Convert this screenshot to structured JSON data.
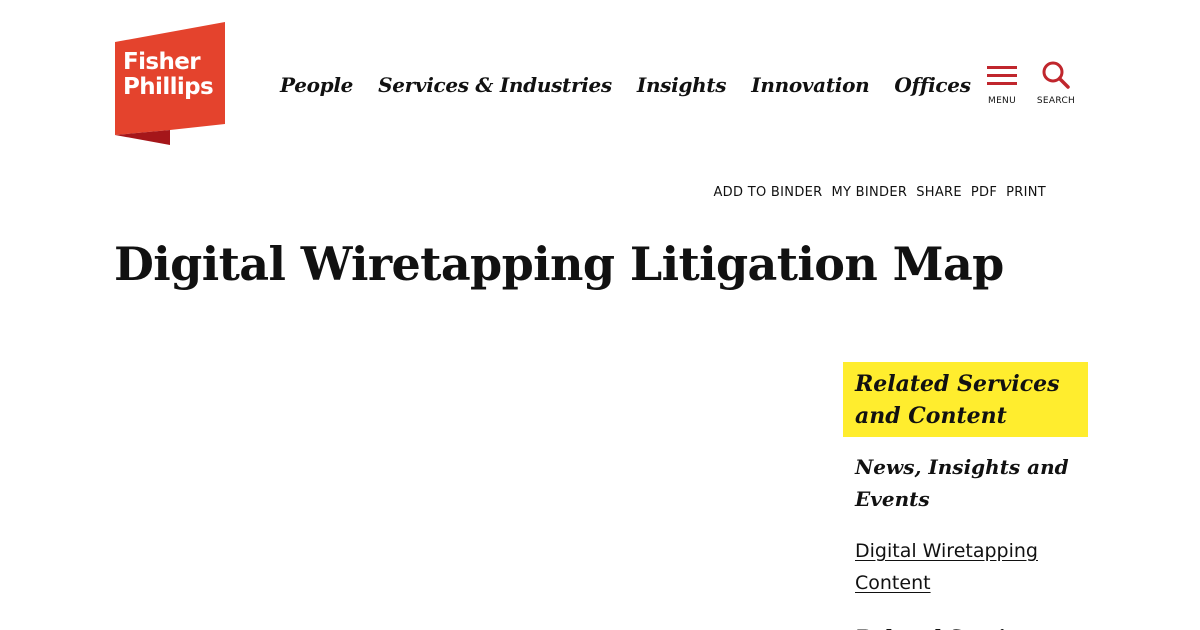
{
  "brand": {
    "line1": "Fisher",
    "line2": "Phillips",
    "color": "#e4432d",
    "shadow_color": "#a5161a"
  },
  "nav": {
    "items": [
      {
        "label": "People"
      },
      {
        "label": "Services & Industries"
      },
      {
        "label": "Insights"
      },
      {
        "label": "Innovation"
      },
      {
        "label": "Offices"
      }
    ]
  },
  "utility": {
    "menu_label": "MENU",
    "menu_icon": "hamburger-icon",
    "search_label": "SEARCH",
    "search_icon": "search-icon",
    "icon_color": "#c0262d"
  },
  "actions": [
    {
      "label": "ADD TO BINDER"
    },
    {
      "label": "MY BINDER"
    },
    {
      "label": "SHARE"
    },
    {
      "label": "PDF"
    },
    {
      "label": "PRINT"
    }
  ],
  "page": {
    "title": "Digital Wiretapping Litigation Map"
  },
  "sidebar": {
    "heading": "Related Services and Content",
    "heading_bg": "#ffed2e",
    "sections": [
      {
        "heading": "News, Insights and Events"
      },
      {
        "link": "Digital Wiretapping Content"
      },
      {
        "heading": "Related Services"
      }
    ]
  }
}
